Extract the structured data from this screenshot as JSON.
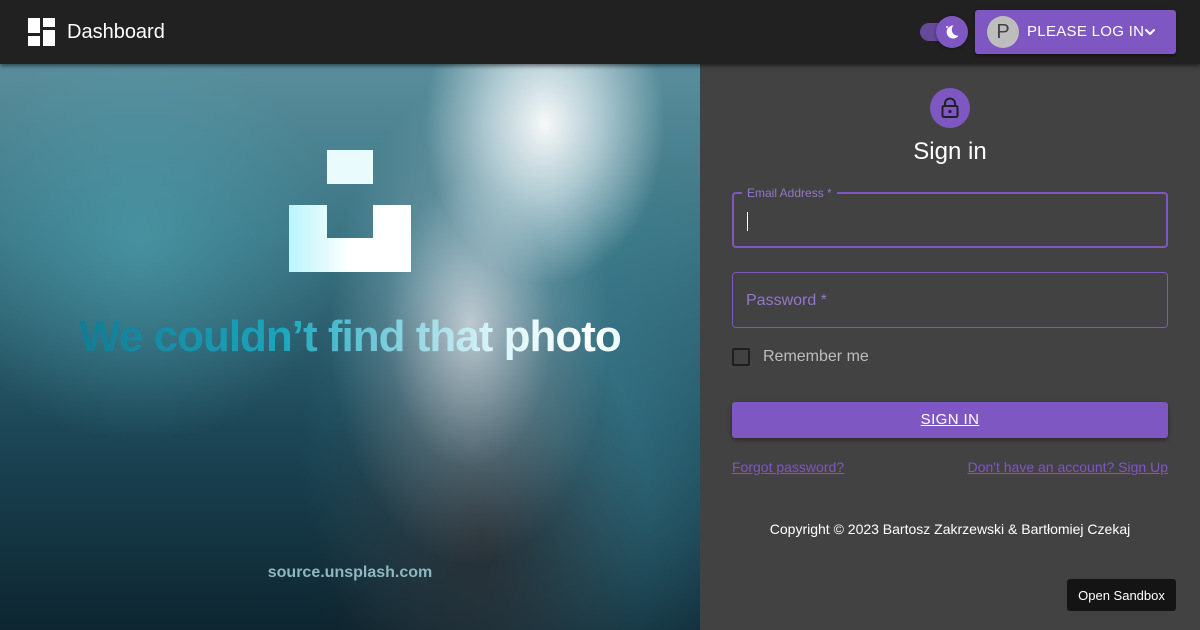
{
  "appbar": {
    "title": "Dashboard",
    "logo_icon": "dashboard-icon",
    "theme_toggle_icon": "moon-icon",
    "user_avatar_letter": "P",
    "user_label": "PLEASE LOG IN",
    "user_menu_icon": "chevron-down-icon"
  },
  "photo": {
    "logo_icon": "unsplash-logo",
    "error_text": "We couldn’t find that photo",
    "source_text": "source.unsplash.com"
  },
  "signin": {
    "lock_icon": "lock-icon",
    "title": "Sign in",
    "email_label": "Email Address *",
    "email_value": "",
    "password_placeholder": "Password *",
    "password_value": "",
    "remember_label": "Remember me",
    "remember_checked": false,
    "submit_label": "SIGN IN",
    "forgot_link": "Forgot password?",
    "signup_link": "Don't have an account? Sign Up",
    "copyright": "Copyright © 2023 Bartosz Zakrzewski & Bartłomiej Czekaj"
  },
  "sandbox_button": "Open Sandbox",
  "colors": {
    "primary": "#7e57c2",
    "appbar": "#212121",
    "panel": "#424242"
  }
}
